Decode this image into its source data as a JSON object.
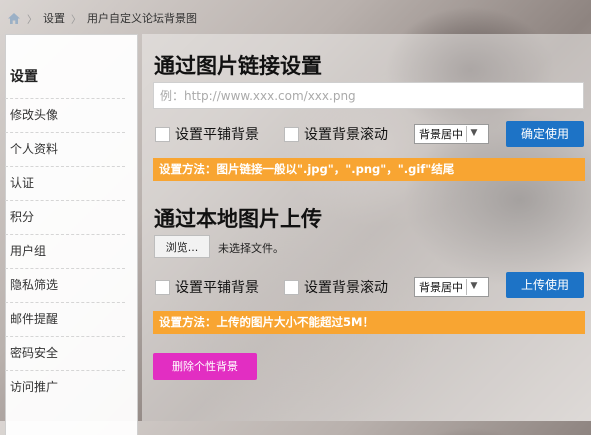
{
  "breadcrumb": {
    "items": [
      "设置",
      "用户自定义论坛背景图"
    ]
  },
  "sidebar": {
    "title": "设置",
    "items": [
      "修改头像",
      "个人资料",
      "认证",
      "积分",
      "用户组",
      "隐私筛选",
      "邮件提醒",
      "密码安全",
      "访问推广"
    ]
  },
  "link_section": {
    "title": "通过图片链接设置",
    "url_placeholder": "例：http://www.xxx.com/xxx.png",
    "tile_label": "设置平铺背景",
    "scroll_label": "设置背景滚动",
    "position_select": "背景居中",
    "confirm_button": "确定使用",
    "tip": "设置方法：图片链接一般以\".jpg\"，\".png\"，\".gif\"结尾"
  },
  "local_section": {
    "title": "通过本地图片上传",
    "browse_button": "浏览...",
    "file_status": "未选择文件。",
    "tile_label": "设置平铺背景",
    "scroll_label": "设置背景滚动",
    "position_select": "背景居中",
    "upload_button": "上传使用",
    "tip": "设置方法：上传的图片大小不能超过5M！"
  },
  "delete_button": "删除个性背景",
  "colors": {
    "accent_blue": "#1d73c6",
    "tip_orange": "#f8a532",
    "delete_pink": "#e22ec2"
  }
}
